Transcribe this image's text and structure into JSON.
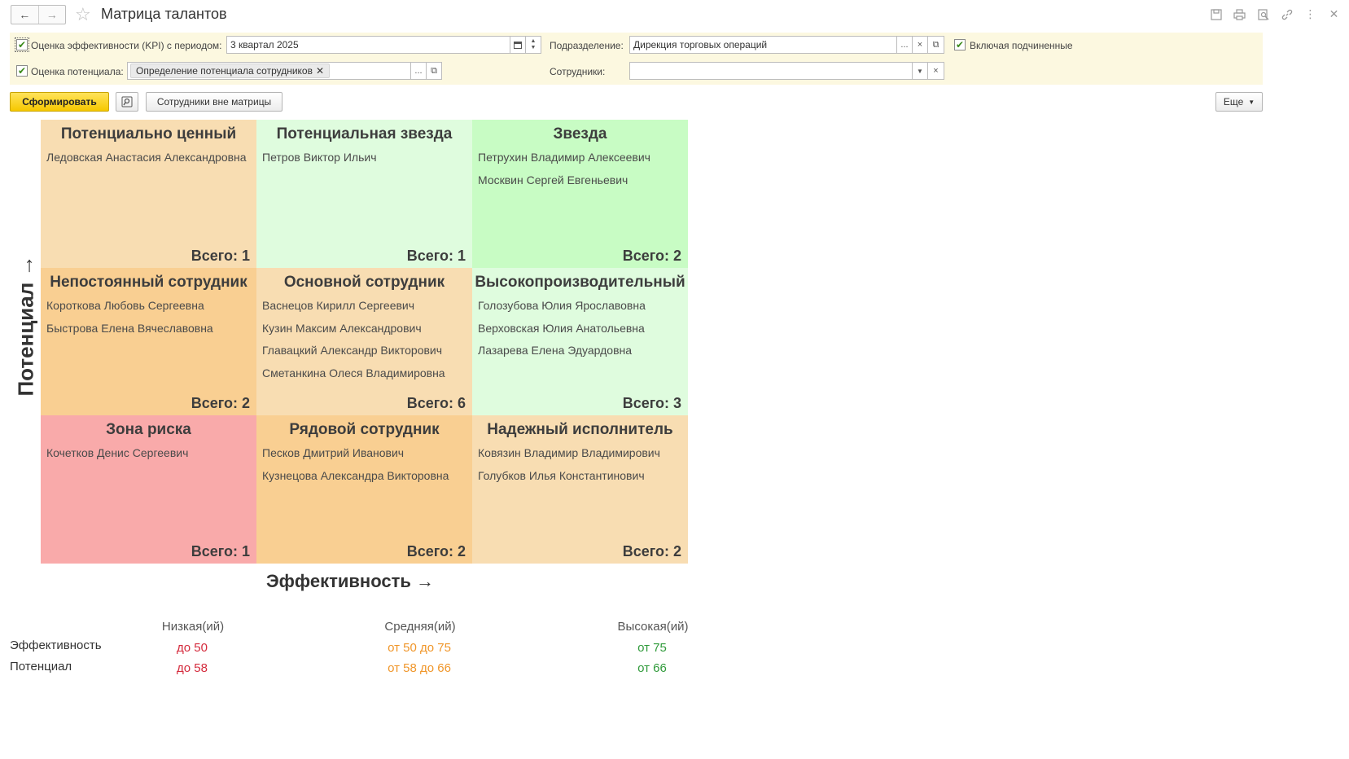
{
  "window": {
    "title": "Матрица талантов"
  },
  "filters": {
    "kpi": {
      "label": "Оценка эффективности (KPI) с периодом:",
      "value": "3 квартал 2025",
      "checked": true
    },
    "potential": {
      "label": "Оценка потенциала:",
      "tag": "Определение потенциала сотрудников",
      "checked": true
    },
    "department": {
      "label": "Подразделение:",
      "value": "Дирекция торговых операций"
    },
    "include_sub": {
      "label": "Включая подчиненные",
      "checked": true
    },
    "employees": {
      "label": "Сотрудники:",
      "value": ""
    }
  },
  "toolbar": {
    "generate_label": "Сформировать",
    "outside_label": "Сотрудники вне матрицы",
    "more_label": "Еще"
  },
  "matrix": {
    "y_axis_label": "Потенциал →",
    "x_axis_label": "Эффективность →",
    "cells": [
      {
        "title": "Потенциально ценный",
        "color": "#f8ddb2",
        "employees": [
          "Ледовская Анастасия Александровна"
        ],
        "total": "Всего: 1"
      },
      {
        "title": "Потенциальная звезда",
        "color": "#dffcde",
        "employees": [
          "Петров Виктор Ильич"
        ],
        "total": "Всего: 1"
      },
      {
        "title": "Звезда",
        "color": "#c8fcc4",
        "employees": [
          "Петрухин Владимир Алексеевич",
          "Москвин Сергей Евгеньевич"
        ],
        "total": "Всего: 2"
      },
      {
        "title": "Непостоянный сотрудник",
        "color": "#f9cf92",
        "employees": [
          "Короткова Любовь Сергеевна",
          "Быстрова Елена Вячеславовна"
        ],
        "total": "Всего: 2"
      },
      {
        "title": "Основной сотрудник",
        "color": "#f8ddb2",
        "employees": [
          "Васнецов Кирилл Сергеевич",
          "Кузин Максим Александрович",
          "Главацкий Александр Викторович",
          "Сметанкина Олеся Владимировна"
        ],
        "total": "Всего: 6"
      },
      {
        "title": "Высокопроизводительный",
        "color": "#dffcde",
        "employees": [
          "Голозубова Юлия Ярославовна",
          "Верховская Юлия Анатольевна",
          "Лазарева Елена Эдуардовна"
        ],
        "total": "Всего: 3"
      },
      {
        "title": "Зона риска",
        "color": "#f9aaaa",
        "employees": [
          "Кочетков Денис Сергеевич"
        ],
        "total": "Всего: 1"
      },
      {
        "title": "Рядовой сотрудник",
        "color": "#f9cf92",
        "employees": [
          "Песков Дмитрий Иванович",
          "Кузнецова Александра Викторовна"
        ],
        "total": "Всего: 2"
      },
      {
        "title": "Надежный исполнитель",
        "color": "#f8ddb2",
        "employees": [
          "Ковязин Владимир Владимирович",
          "Голубков Илья Константинович"
        ],
        "total": "Всего: 2"
      }
    ]
  },
  "legend": {
    "headers": [
      "Низкая(ий)",
      "Средняя(ий)",
      "Высокая(ий)"
    ],
    "rows": [
      {
        "label": "Эффективность",
        "values": [
          "до 50",
          "от 50 до 75",
          "от 75"
        ]
      },
      {
        "label": "Потенциал",
        "values": [
          "до 58",
          "от 58 до 66",
          "от 66"
        ]
      }
    ],
    "colors": [
      "#d42a3c",
      "#f0962a",
      "#2f9a3a"
    ]
  }
}
